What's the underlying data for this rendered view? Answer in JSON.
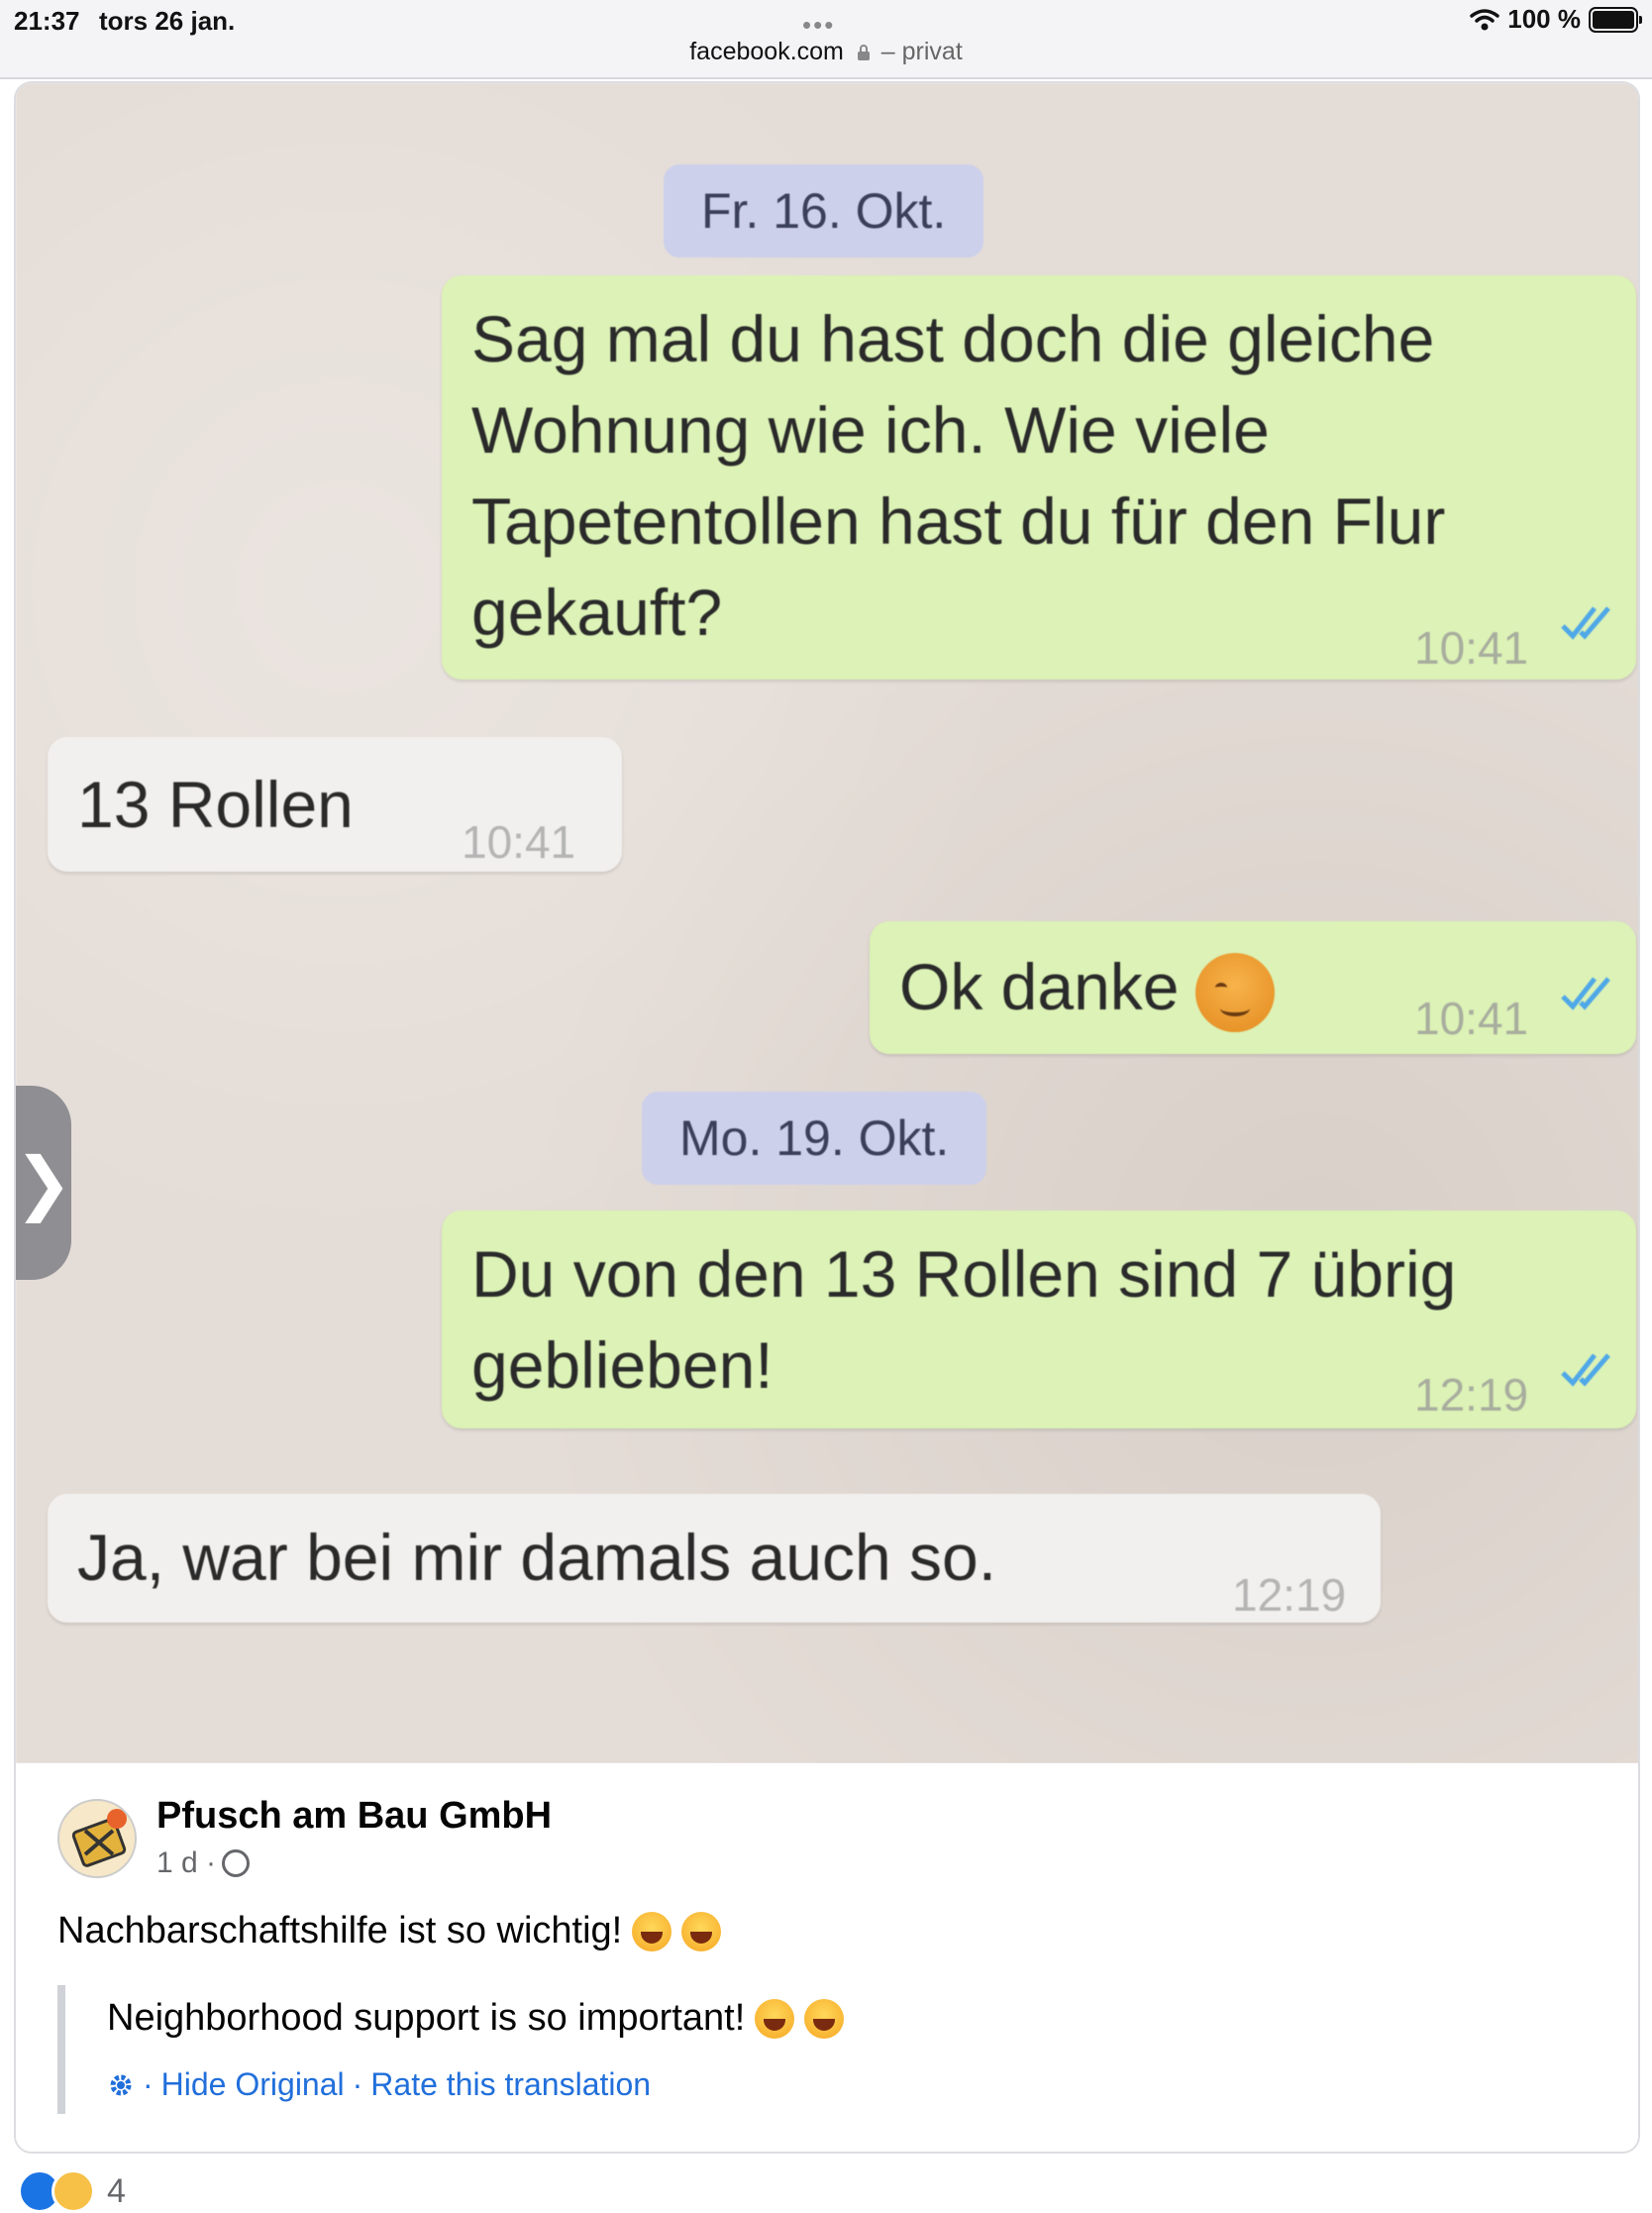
{
  "status_bar": {
    "time": "21:37",
    "date": "tors 26 jan.",
    "url": "facebook.com",
    "privacy": "– privat",
    "battery": "100 %"
  },
  "chat": {
    "dates": [
      "Fr. 16. Okt.",
      "Mo. 19. Okt."
    ],
    "messages": [
      {
        "dir": "out",
        "text": "Sag mal du hast doch die gleiche Wohnung wie ich. Wie viele Tapetentollen hast du für den Flur gekauft?",
        "time": "10:41"
      },
      {
        "dir": "in",
        "text": "13 Rollen",
        "time": "10:41"
      },
      {
        "dir": "out",
        "text": "Ok danke",
        "time": "10:41"
      },
      {
        "dir": "out",
        "text": "Du von den 13 Rollen sind 7 übrig geblieben!",
        "time": "12:19"
      },
      {
        "dir": "in",
        "text": "Ja, war bei mir damals auch so.",
        "time": "12:19"
      }
    ],
    "msg1_lines": [
      "Sag mal du hast doch die gleiche",
      "Wohnung wie ich. Wie viele",
      "Tapetentollen hast du für den Flur",
      "gekauft?"
    ],
    "msg4_lines": [
      "Du von den 13 Rollen sind 7 übrig",
      "geblieben!"
    ]
  },
  "post": {
    "author": "Pfusch am Bau GmbH",
    "age": "1 d ·",
    "text": "Nachbarschaftshilfe ist so wichtig!",
    "translation": "Neighborhood support is so important!",
    "links": {
      "sep1": "·",
      "hide_original": "Hide Original",
      "sep2": "·",
      "rate": "Rate this translation"
    },
    "reaction_count": "4"
  },
  "colors": {
    "outgoing_bubble": "#dcf2b6",
    "incoming_bubble": "#f2f0ee",
    "date_pill": "#ccd0ea",
    "link_blue": "#216fdb",
    "read_ticks": "#4fa8e8"
  },
  "icons": [
    "wifi-icon",
    "battery-icon",
    "lock-icon",
    "globe-icon",
    "gear-icon",
    "read-ticks-icon",
    "chevron-right-icon"
  ]
}
